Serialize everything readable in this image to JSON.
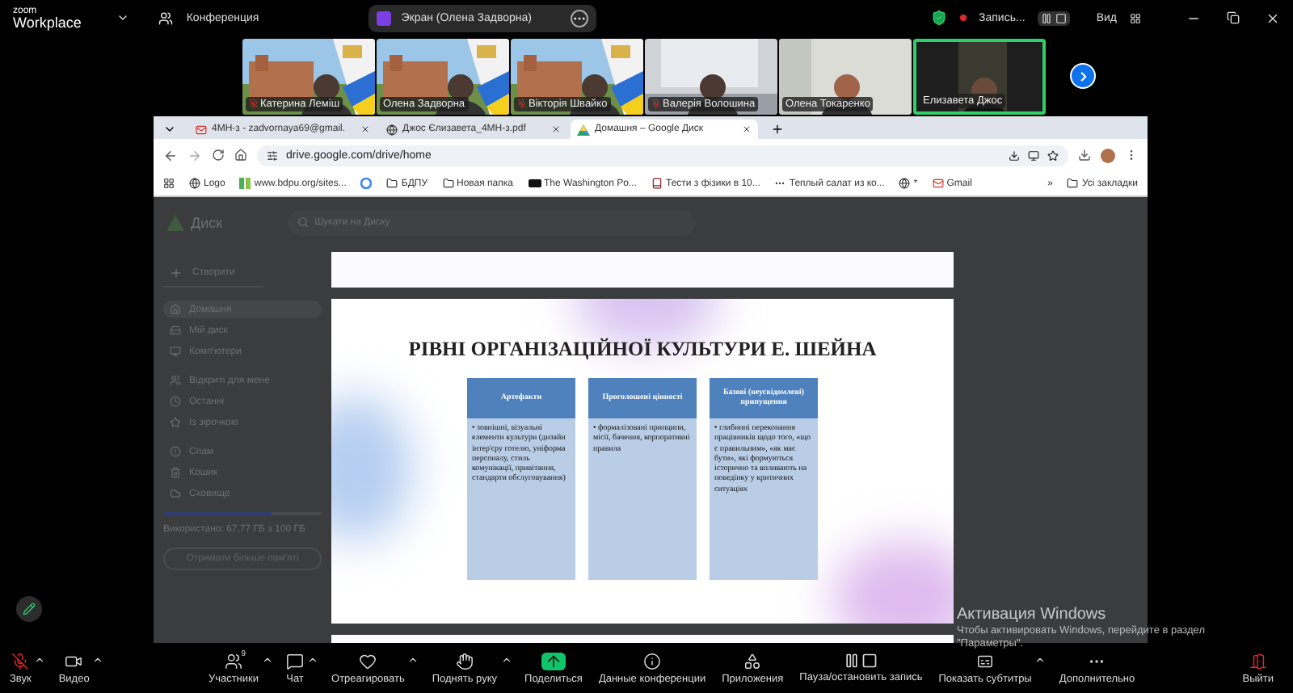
{
  "topbar": {
    "logo_top": "zoom",
    "logo_bottom": "Workplace",
    "meeting": "Конференция",
    "share_label": "Экран (Олена Задворна)",
    "recording": "Запись...",
    "view": "Вид"
  },
  "participants": [
    {
      "name": "Катерина Леміш",
      "muted": true,
      "speaking": false
    },
    {
      "name": "Олена Задворна",
      "muted": false,
      "speaking": false
    },
    {
      "name": "Вікторія Швайко",
      "muted": true,
      "speaking": false
    },
    {
      "name": "Валерія Волошина",
      "muted": true,
      "speaking": false
    },
    {
      "name": "Олена Токаренко",
      "muted": false,
      "speaking": false
    },
    {
      "name": "Елизавета Джос",
      "muted": false,
      "speaking": true
    }
  ],
  "browser": {
    "tabs": [
      {
        "label": "4МН-з - zadvornaya69@gmail.",
        "selected": false
      },
      {
        "label": "Джос Єлизавета_4МН-з.pdf",
        "selected": false
      },
      {
        "label": "Домашня – Google Диск",
        "selected": true
      }
    ],
    "url": "drive.google.com/drive/home",
    "bookmarks": [
      {
        "label": "Logo"
      },
      {
        "label": "www.bdpu.org/sites..."
      },
      {
        "label": "БДПУ"
      },
      {
        "label": "Новая папка"
      },
      {
        "label": "The Washington Po..."
      },
      {
        "label": "Тести з фізики в 10..."
      },
      {
        "label": "Теплый салат из ко..."
      },
      {
        "label": "*"
      },
      {
        "label": "Gmail"
      }
    ],
    "more": "»",
    "all_bookmarks": "Усі закладки"
  },
  "drive": {
    "title": "Диск",
    "search_placeholder": "Шукати на Диску",
    "create": "Створити",
    "nav": [
      {
        "label": "Домашня",
        "selected": true
      },
      {
        "label": "Мій диск",
        "selected": false
      },
      {
        "label": "Комп'ютери",
        "selected": false
      },
      {
        "label": "Відкриті для мене",
        "selected": false
      },
      {
        "label": "Останні",
        "selected": false
      },
      {
        "label": "Із зірочкою",
        "selected": false
      },
      {
        "label": "Спам",
        "selected": false
      },
      {
        "label": "Кошик",
        "selected": false
      },
      {
        "label": "Сховище",
        "selected": false
      }
    ],
    "storage": {
      "text": "Використано: 67,77 ГБ з 100 ГБ",
      "level": 0.68
    },
    "get_more": "Отримати більше пам'яті"
  },
  "slide": {
    "title": "РІВНІ ОРГАНІЗАЦІЙНОЇ КУЛЬТУРИ Е. ШЕЙНА",
    "columns": [
      {
        "header": "Артефакти",
        "body": "• зовнішні, візуальні елементи культури (дизайн інтер'єру готелю, уніформа персоналу, стиль комунікації, привітання, стандарти обслуговування)"
      },
      {
        "header": "Проголошені цінності",
        "body": "• формалізовані принципи, місії, бачення, корпоративні правила"
      },
      {
        "header": "Базові (неусвідомлені) припущення",
        "body": "• глибинні переконання працівників щодо того, «що є правильним», «як має бути», які формуються історично та впливають на поведінку у критичних ситуаціях"
      }
    ]
  },
  "windows_notice": {
    "title": "Активация Windows",
    "text": "Чтобы активировать Windows, перейдите в раздел \"Параметры\"."
  },
  "toolbar": [
    {
      "label": "Звук",
      "kind": "mic",
      "muted": true
    },
    {
      "label": "Видео",
      "kind": "video"
    },
    {
      "label": "Участники",
      "kind": "users",
      "badge": "9"
    },
    {
      "label": "Чат",
      "kind": "chat"
    },
    {
      "label": "Отреагировать",
      "kind": "heart"
    },
    {
      "label": "Поднять руку",
      "kind": "hand"
    },
    {
      "label": "Поделиться",
      "kind": "share",
      "active": true
    },
    {
      "label": "Данные конференции",
      "kind": "info"
    },
    {
      "label": "Приложения",
      "kind": "apps"
    },
    {
      "label": "Пауза/остановить запись",
      "kind": "record"
    },
    {
      "label": "Показать субтитры",
      "kind": "cc"
    },
    {
      "label": "Дополнительно",
      "kind": "more"
    },
    {
      "label": "Выйти",
      "kind": "leave"
    }
  ]
}
